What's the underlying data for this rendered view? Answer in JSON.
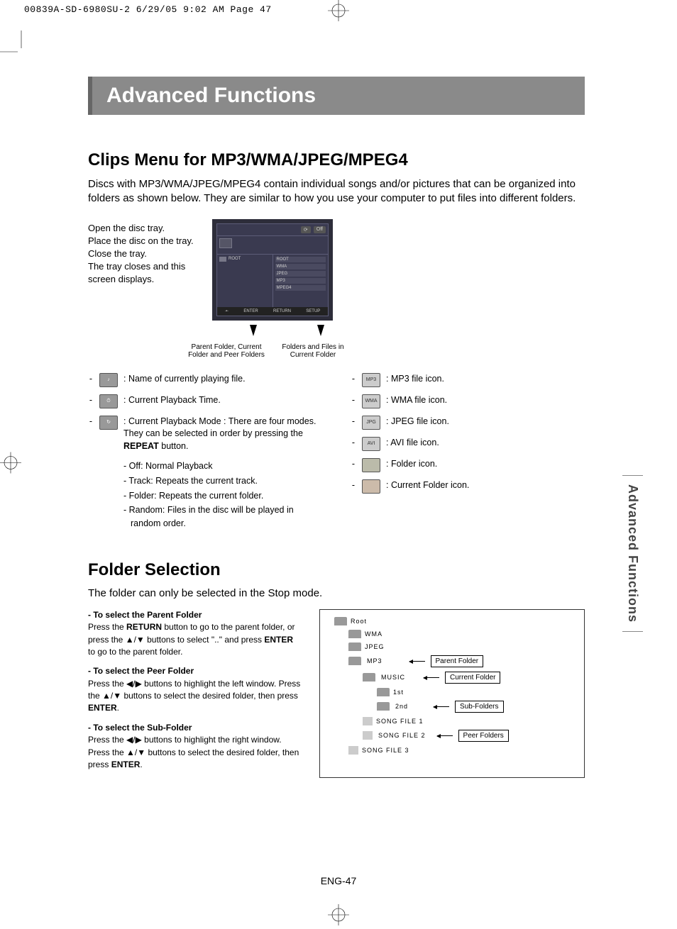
{
  "print_header": "00839A-SD-6980SU-2  6/29/05  9:02 AM  Page 47",
  "banner": "Advanced Functions",
  "side_tab": "Advanced Functions",
  "page_num": "ENG-47",
  "clips": {
    "heading": "Clips Menu for MP3/WMA/JPEG/MPEG4",
    "intro": "Discs with MP3/WMA/JPEG/MPEG4 contain individual songs and/or pictures that can be organized into folders as shown below. They are similar to how you use your computer to put files into different folders.",
    "steps": "Open the disc tray.\nPlace the disc on the tray.\nClose the tray.\nThe tray closes and this screen displays.",
    "tv_off": "Off",
    "tv_root_left": "ROOT",
    "tv_items": [
      "ROOT",
      "WMA",
      "JPEG",
      "MP3",
      "MPEG4"
    ],
    "tv_bottom": [
      "ENTER",
      "RETURN",
      "SETUP"
    ],
    "caption_left": "Parent Folder, Current Folder and Peer Folders",
    "caption_right": "Folders and Files in Current Folder",
    "legend_left": {
      "playing_file": ": Name of currently playing file.",
      "playback_time": ": Current Playback Time.",
      "playback_mode": ": Current Playback Mode : There are four modes. They can be selected in order by pressing the ",
      "repeat": "REPEAT",
      "playback_mode_tail": " button.",
      "sub": [
        "- Off: Normal Playback",
        "- Track: Repeats the current track.",
        "- Folder: Repeats the current folder.",
        "- Random: Files in the disc will be played in random order."
      ]
    },
    "legend_right": {
      "mp3": ": MP3 file icon.",
      "wma": ": WMA file icon.",
      "jpeg": ": JPEG file icon.",
      "avi": ": AVI file icon.",
      "folder": ": Folder icon.",
      "current_folder": ": Current Folder icon."
    }
  },
  "folder": {
    "heading": "Folder Selection",
    "intro": "The folder can only be selected in the Stop mode.",
    "parent_title": "-  To select the Parent Folder",
    "parent_body_1": "Press the ",
    "parent_return": "RETURN",
    "parent_body_2": " button to go to the parent folder, or press the ▲/▼ buttons to select \"..\" and press ",
    "parent_enter": "ENTER",
    "parent_body_3": " to go to the parent folder.",
    "peer_title": "-  To select the Peer Folder",
    "peer_body_1": "Press the ◀/▶ buttons to highlight the left window. Press the ▲/▼ buttons to select the desired folder, then press ",
    "peer_enter": "ENTER",
    "peer_body_2": ".",
    "sub_title": "-  To select the Sub-Folder",
    "sub_body_1": "Press the ◀/▶ buttons to highlight the right window. Press the ▲/▼ buttons to select the desired folder, then press ",
    "sub_enter": "ENTER",
    "sub_body_2": ".",
    "tree": {
      "root": "Root",
      "wma": "WMA",
      "jpeg": "JPEG",
      "mp3": "MP3",
      "music": "MUSIC",
      "first": "1st",
      "second": "2nd",
      "sf1": "SONG FILE 1",
      "sf2": "SONG FILE 2",
      "sf3": "SONG FILE 3"
    },
    "callouts": {
      "parent": "Parent Folder",
      "current": "Current Folder",
      "sub": "Sub-Folders",
      "peer": "Peer Folders"
    }
  }
}
